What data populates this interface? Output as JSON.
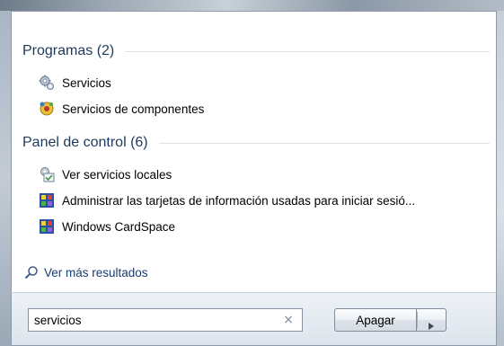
{
  "sections": [
    {
      "title": "Programas (2)",
      "items": [
        {
          "label": "Servicios",
          "icon": "gears-icon"
        },
        {
          "label": "Servicios de componentes",
          "icon": "component-services-icon"
        }
      ]
    },
    {
      "title": "Panel de control (6)",
      "items": [
        {
          "label": "Ver servicios locales",
          "icon": "local-services-icon"
        },
        {
          "label": "Administrar las tarjetas de información usadas para iniciar sesió...",
          "icon": "cardspace-icon"
        },
        {
          "label": "Windows CardSpace",
          "icon": "cardspace-icon"
        }
      ]
    }
  ],
  "more_results": {
    "label": "Ver más resultados",
    "icon": "search-icon"
  },
  "search": {
    "value": "servicios",
    "clear_icon": "clear-icon"
  },
  "shutdown": {
    "label": "Apagar",
    "arrow_icon": "triangle-right-icon"
  },
  "colors": {
    "section_title": "#1e395b",
    "link": "#1a3b6e",
    "bottom_bar": "#dde4ec"
  }
}
